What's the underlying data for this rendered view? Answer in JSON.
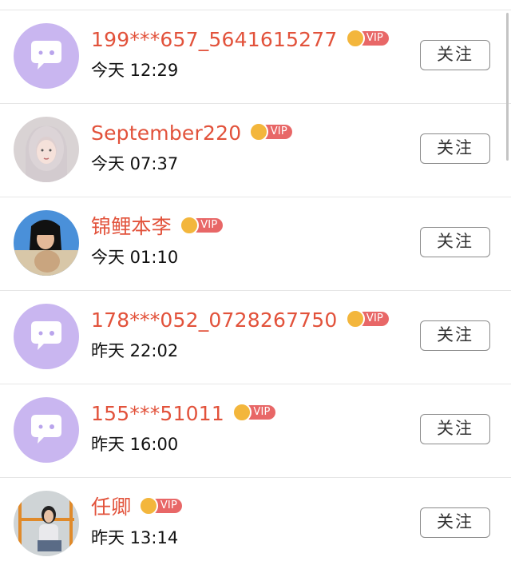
{
  "follow_label": "关注",
  "vip_label": "VIP",
  "colors": {
    "name": "#e2523b",
    "vip_badge": "#e86767",
    "crown": "#f3b63c",
    "default_avatar": "#c9b6f0"
  },
  "users": [
    {
      "name": "199***657_5641615277",
      "time": "今天 12:29",
      "avatar": "default-avatar"
    },
    {
      "name": "September220",
      "time": "今天 07:37",
      "avatar": "photo-avatar"
    },
    {
      "name": "锦鲤本李",
      "time": "今天 01:10",
      "avatar": "photo-avatar"
    },
    {
      "name": "178***052_0728267750",
      "time": "昨天 22:02",
      "avatar": "default-avatar"
    },
    {
      "name": "155***51011",
      "time": "昨天 16:00",
      "avatar": "default-avatar"
    },
    {
      "name": "任卿",
      "time": "昨天 13:14",
      "avatar": "photo-avatar"
    }
  ]
}
